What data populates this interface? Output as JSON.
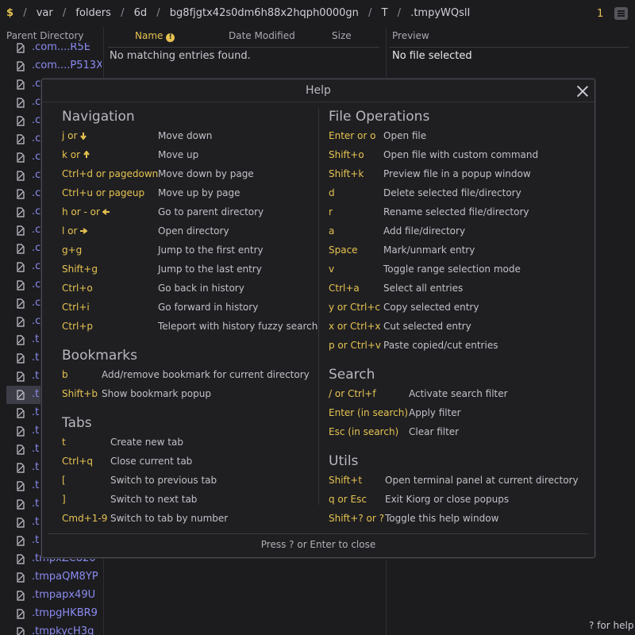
{
  "breadcrumb": {
    "home": "$",
    "segments": [
      "var",
      "folders",
      "6d",
      "bg8fjgtx42s0dm6h88x2hqph0000gn",
      "T",
      ".tmpyWQslI"
    ]
  },
  "tab_count": "1",
  "columns": {
    "parent": "Parent Directory",
    "name": "Name",
    "date": "Date Modified",
    "size": "Size",
    "preview": "Preview"
  },
  "main_empty": "No matching entries found.",
  "preview_empty": "No file selected",
  "parent_items": [
    ".com....R5E",
    ".com....P513X",
    ".c",
    ".c",
    ".c",
    ".c",
    ".c",
    ".c",
    ".c",
    ".c",
    ".c",
    ".c",
    ".c",
    ".c",
    ".c",
    ".c",
    ".t",
    ".t",
    ".t",
    ".t",
    ".t",
    ".t",
    ".t",
    ".t",
    ".t",
    ".t",
    ".t",
    ".t",
    ".tmpxZC820",
    ".tmpaQM8YP",
    ".tmpapx49U",
    ".tmpgHKBR9",
    ".tmpkycH3q"
  ],
  "status_help": "? for help",
  "help": {
    "title": "Help",
    "footer": "Press ? or Enter to close",
    "navigation": {
      "title": "Navigation",
      "rows": [
        {
          "k": "j or",
          "arrow": "down",
          "d": "Move down"
        },
        {
          "k": "k or",
          "arrow": "up",
          "d": "Move up"
        },
        {
          "k": "Ctrl+d or pagedown",
          "d": "Move down by page"
        },
        {
          "k": "Ctrl+u or pageup",
          "d": "Move up by page"
        },
        {
          "k": "h or - or",
          "arrow": "left",
          "d": "Go to parent directory"
        },
        {
          "k": "l or",
          "arrow": "right",
          "d": "Open directory"
        },
        {
          "k": "g+g",
          "d": "Jump to the first entry"
        },
        {
          "k": "Shift+g",
          "d": "Jump to the last entry"
        },
        {
          "k": "Ctrl+o",
          "d": "Go back in history"
        },
        {
          "k": "Ctrl+i",
          "d": "Go forward in history"
        },
        {
          "k": "Ctrl+p",
          "d": "Teleport with history fuzzy search"
        }
      ]
    },
    "bookmarks": {
      "title": "Bookmarks",
      "rows": [
        {
          "k": "b",
          "d": "Add/remove bookmark for current directory"
        },
        {
          "k": "Shift+b",
          "d": "Show bookmark popup"
        }
      ]
    },
    "tabs": {
      "title": "Tabs",
      "rows": [
        {
          "k": "t",
          "d": "Create new tab"
        },
        {
          "k": "Ctrl+q",
          "d": "Close current tab"
        },
        {
          "k": "[",
          "d": "Switch to previous tab"
        },
        {
          "k": "]",
          "d": "Switch to next tab"
        },
        {
          "k": "Cmd+1-9",
          "d": "Switch to tab by number"
        }
      ]
    },
    "file_operations": {
      "title": "File Operations",
      "rows": [
        {
          "k": "Enter or o",
          "d": "Open file"
        },
        {
          "k": "Shift+o",
          "d": "Open file with custom command"
        },
        {
          "k": "Shift+k",
          "d": "Preview file in a popup window"
        },
        {
          "k": "d",
          "d": "Delete selected file/directory"
        },
        {
          "k": "r",
          "d": "Rename selected file/directory"
        },
        {
          "k": "a",
          "d": "Add file/directory"
        },
        {
          "k": "Space",
          "d": "Mark/unmark entry"
        },
        {
          "k": "v",
          "d": "Toggle range selection mode"
        },
        {
          "k": "Ctrl+a",
          "d": "Select all entries"
        },
        {
          "k": "y or Ctrl+c",
          "d": "Copy selected entry"
        },
        {
          "k": "x or Ctrl+x",
          "d": "Cut selected entry"
        },
        {
          "k": "p or Ctrl+v",
          "d": "Paste copied/cut entries"
        }
      ]
    },
    "search": {
      "title": "Search",
      "rows": [
        {
          "k": "/ or Ctrl+f",
          "d": "Activate search filter"
        },
        {
          "k": "Enter (in search)",
          "d": "Apply filter"
        },
        {
          "k": "Esc (in search)",
          "d": "Clear filter"
        }
      ]
    },
    "utils": {
      "title": "Utils",
      "rows": [
        {
          "k": "Shift+t",
          "d": "Open terminal panel at current directory"
        },
        {
          "k": "q or Esc",
          "d": "Exit Kiorg or close popups"
        },
        {
          "k": "Shift+? or ?",
          "d": "Toggle this help window"
        }
      ]
    }
  }
}
